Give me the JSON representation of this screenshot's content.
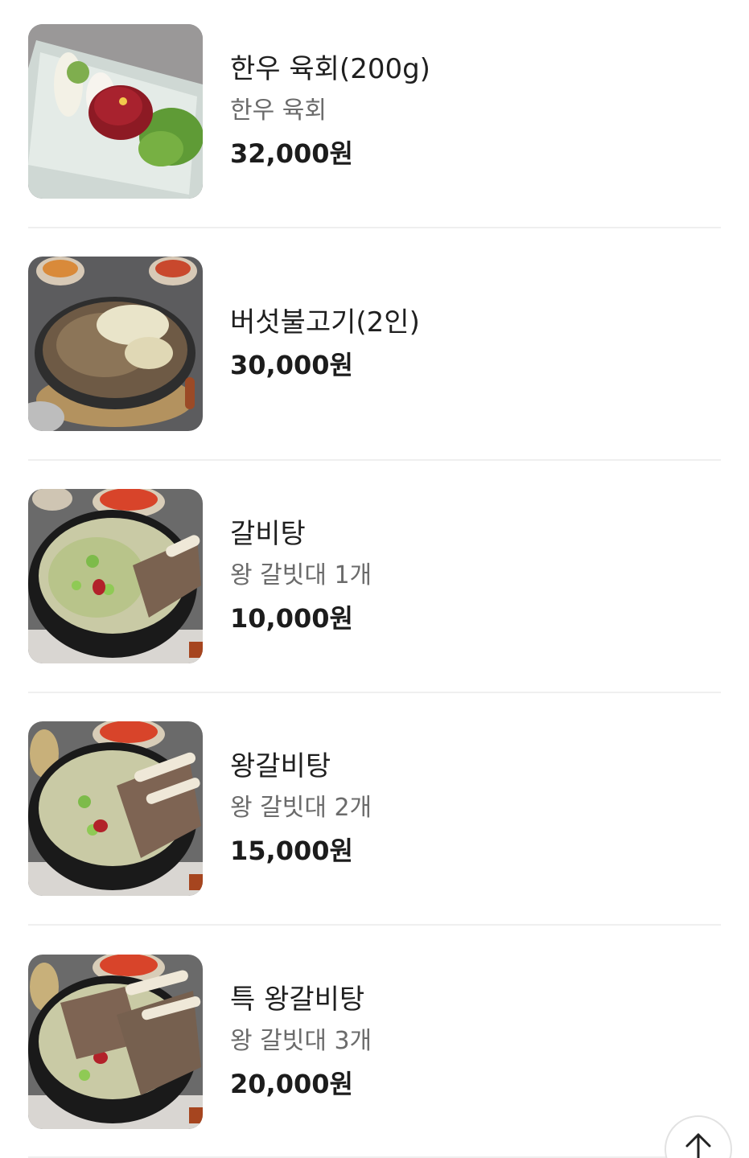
{
  "menu": {
    "items": [
      {
        "name": "한우 육회(200g)",
        "description": "한우 육회",
        "price": "32,000원",
        "image_icon": "beef-tartare-image"
      },
      {
        "name": "버섯불고기(2인)",
        "description": "",
        "price": "30,000원",
        "image_icon": "mushroom-bulgogi-image"
      },
      {
        "name": "갈비탕",
        "description": "왕 갈빗대 1개",
        "price": "10,000원",
        "image_icon": "galbitang-image"
      },
      {
        "name": "왕갈비탕",
        "description": "왕 갈빗대 2개",
        "price": "15,000원",
        "image_icon": "wang-galbitang-image"
      },
      {
        "name": "특 왕갈비탕",
        "description": "왕 갈빗대 3개",
        "price": "20,000원",
        "image_icon": "special-wang-galbitang-image"
      }
    ]
  },
  "controls": {
    "scroll_top_icon": "arrow-up-icon"
  },
  "colors": {
    "price": "#1c1c1c",
    "description": "#6b6b6b",
    "divider": "#efefef"
  }
}
